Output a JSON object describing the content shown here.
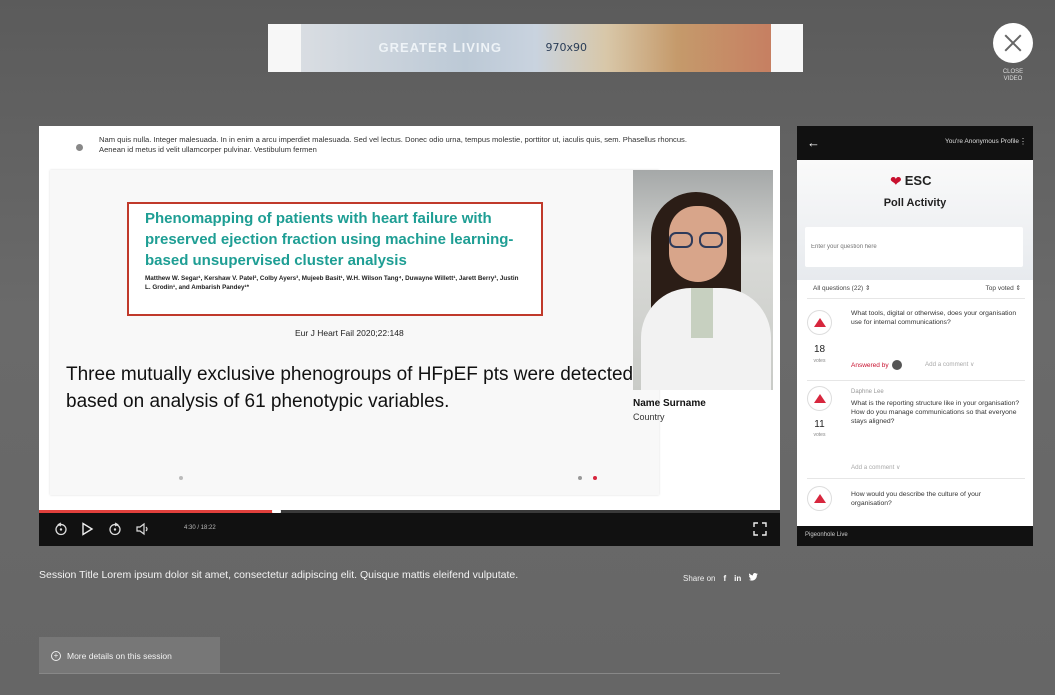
{
  "ad": {
    "brand_text": "GREATER LIVING",
    "size_label": "970x90"
  },
  "close": {
    "label": "CLOSE VIDEO"
  },
  "slide": {
    "header_text": "Nam quis nulla. Integer malesuada. In in enim a arcu imperdiet malesuada. Sed vel lectus. Donec odio urna, tempus molestie, porttitor ut, iaculis quis, sem. Phasellus rhoncus. Aenean id metus id velit ullamcorper pulvinar. Vestibulum fermen",
    "paper_title": "Phenomapping of patients with heart failure with preserved ejection fraction using machine learning-based unsupervised cluster analysis",
    "paper_authors": "Matthew W. Segar¹, Kershaw V. Patel², Colby Ayers³, Mujeeb Basit¹, W.H. Wilson Tang⁴, Duwayne Willett¹, Jarett Berry³, Justin L. Grodin¹, and Ambarish Pandey¹*",
    "citation": "Eur J Heart Fail 2020;22:148",
    "main_text": "Three mutually exclusive phenogroups of HFpEF pts were detected based on analysis of 61 phenotypic variables."
  },
  "speaker": {
    "name": "Name Surname",
    "country": "Country"
  },
  "player": {
    "time": "4:30 / 18:22",
    "progress": 0.32,
    "accent": "#e0403c"
  },
  "poll": {
    "profile_label": "You're Anonymous Profile",
    "brand": "ESC",
    "title": "Poll Activity",
    "input_placeholder": "Enter your question here",
    "filter": "All questions (22) ⇕",
    "sort": "Top voted ⇕",
    "questions": [
      {
        "votes": "18",
        "votes_label": "votes",
        "text": "What tools, digital or otherwise, does your organisation use for internal communications?",
        "answered_label": "Answered by",
        "comment": "Add a comment ∨"
      },
      {
        "author": "Daphne Lee",
        "votes": "11",
        "votes_label": "votes",
        "text": "What is the reporting structure like in your organisation? How do you manage communications so that everyone stays aligned?",
        "comment": "Add a comment ∨"
      },
      {
        "text": "How would you describe the culture of your organisation?"
      }
    ],
    "footer": "Pigeonhole Live"
  },
  "session": {
    "title": "Session Title Lorem ipsum dolor sit amet, consectetur adipiscing elit. Quisque mattis eleifend vulputate.",
    "share_label": "Share on",
    "share_icons": [
      "f",
      "in",
      "twitter"
    ],
    "more_label": "More details on this session"
  },
  "colors": {
    "esc_red": "#c8102e",
    "vote_red": "#d7263d",
    "paper_teal": "#1e9e94"
  }
}
